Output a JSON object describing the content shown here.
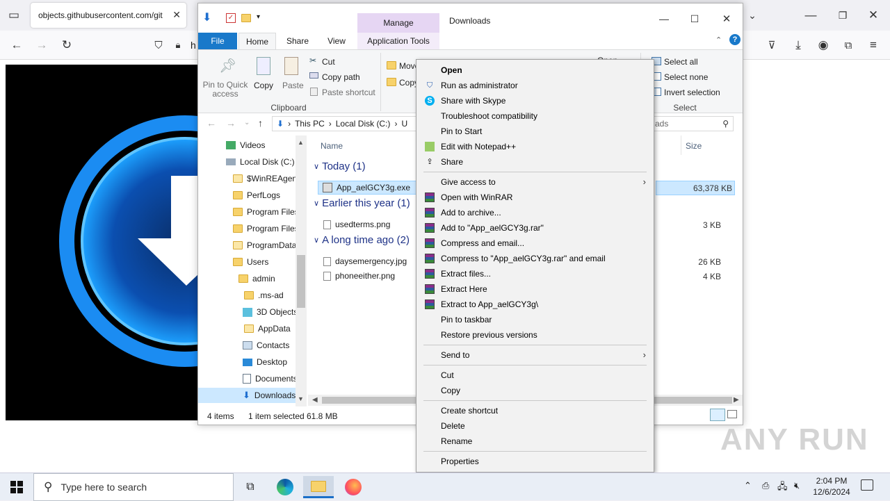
{
  "browser": {
    "tab_title": "objects.githubusercontent.com/git",
    "url_prefix": "h"
  },
  "explorer": {
    "title": "Downloads",
    "manage_tab": "Manage",
    "tabs": [
      "File",
      "Home",
      "Share",
      "View",
      "Application Tools"
    ],
    "ribbon": {
      "pin_label": "Pin to Quick access",
      "copy_label": "Copy",
      "paste_label": "Paste",
      "cut_label": "Cut",
      "copy_path_label": "Copy path",
      "paste_shortcut_label": "Paste shortcut",
      "clipboard_group": "Clipboard",
      "move_label": "Move",
      "copy_to_label": "Copy",
      "open_label": "Open",
      "select_all_label": "Select all",
      "select_none_label": "Select none",
      "invert_selection_label": "Invert selection",
      "select_group": "Select"
    },
    "breadcrumb": [
      "This PC",
      "Local Disk (C:)",
      "U"
    ],
    "search_placeholder": "ads",
    "nav_items": [
      "Videos",
      "Local Disk (C:)",
      "$WinREAgent",
      "PerfLogs",
      "Program Files",
      "Program Files",
      "ProgramData",
      "Users",
      "admin",
      ".ms-ad",
      "3D Objects",
      "AppData",
      "Contacts",
      "Desktop",
      "Documents",
      "Downloads"
    ],
    "columns": {
      "name": "Name",
      "size": "Size"
    },
    "groups": [
      {
        "label": "Today (1)",
        "files": [
          {
            "name": "App_aelGCY3g.exe",
            "size": "63,378 KB"
          }
        ]
      },
      {
        "label": "Earlier this year (1)",
        "files": [
          {
            "name": "usedterms.png",
            "size": "3 KB"
          }
        ]
      },
      {
        "label": "A long time ago (2)",
        "files": [
          {
            "name": "daysemergency.jpg",
            "size": "26 KB"
          },
          {
            "name": "phoneeither.png",
            "size": "4 KB"
          }
        ]
      }
    ],
    "status": {
      "items": "4 items",
      "selected": "1 item selected",
      "size": "61.8 MB"
    }
  },
  "context_menu": {
    "items": [
      "Open",
      "Run as administrator",
      "Share with Skype",
      "Troubleshoot compatibility",
      "Pin to Start",
      "Edit with Notepad++",
      "Share",
      "Give access to",
      "Open with WinRAR",
      "Add to archive...",
      "Add to \"App_aelGCY3g.rar\"",
      "Compress and email...",
      "Compress to \"App_aelGCY3g.rar\" and email",
      "Extract files...",
      "Extract Here",
      "Extract to App_aelGCY3g\\",
      "Pin to taskbar",
      "Restore previous versions",
      "Send to",
      "Cut",
      "Copy",
      "Create shortcut",
      "Delete",
      "Rename",
      "Properties"
    ]
  },
  "taskbar": {
    "search_placeholder": "Type here to search",
    "time": "2:04 PM",
    "date": "12/6/2024"
  },
  "watermark": "ANY RUN"
}
